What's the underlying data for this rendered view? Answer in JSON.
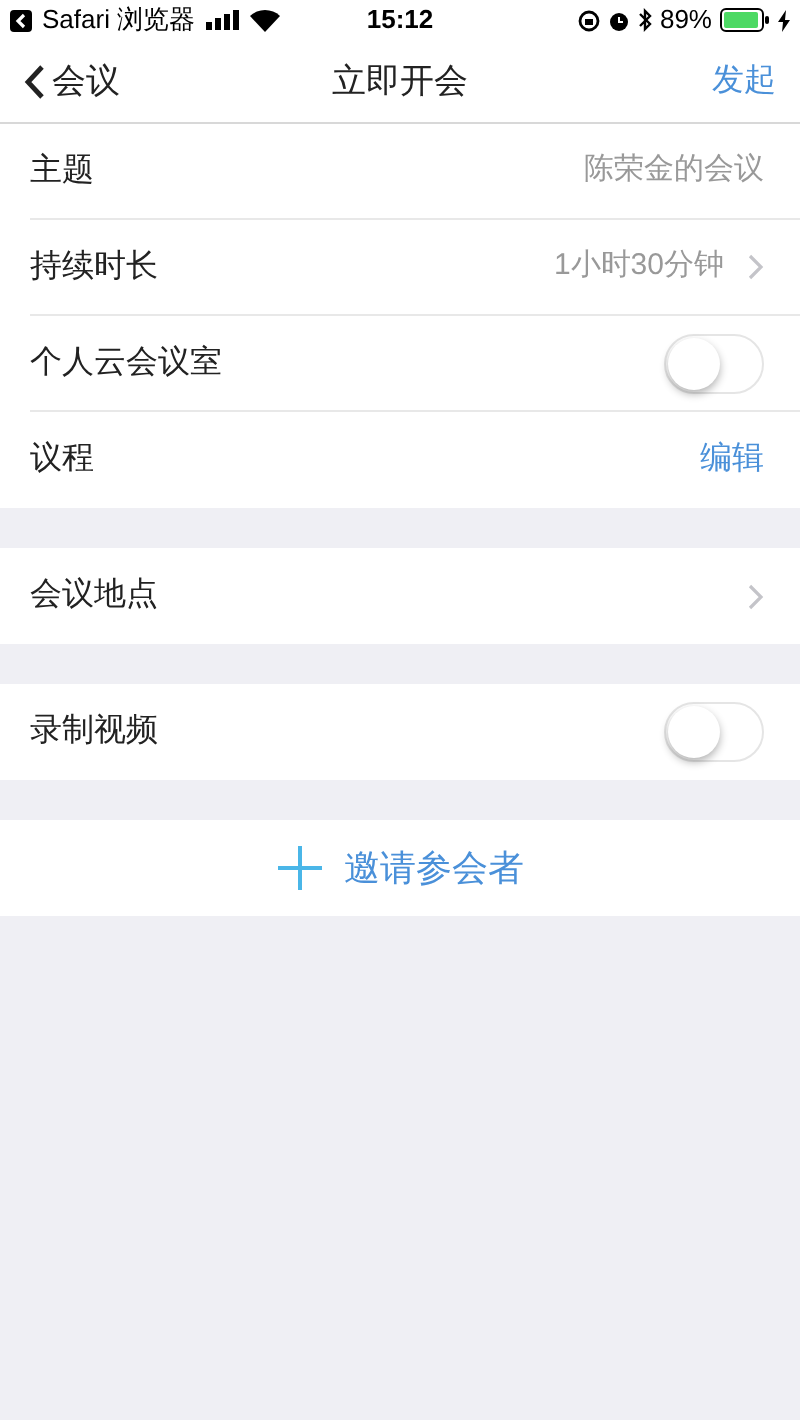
{
  "status_bar": {
    "back_app": "Safari 浏览器",
    "time": "15:12",
    "battery": "89%"
  },
  "nav": {
    "back": "会议",
    "title": "立即开会",
    "action": "发起"
  },
  "sections": [
    {
      "rows": [
        {
          "kind": "value",
          "label": "主题",
          "value": "陈荣金的会议",
          "chevron": false
        },
        {
          "kind": "value",
          "label": "持续时长",
          "value": "1小时30分钟",
          "chevron": true
        },
        {
          "kind": "toggle",
          "label": "个人云会议室",
          "on": false
        },
        {
          "kind": "link",
          "label": "议程",
          "value": "编辑"
        }
      ]
    },
    {
      "rows": [
        {
          "kind": "value",
          "label": "会议地点",
          "chevron": true
        }
      ]
    },
    {
      "rows": [
        {
          "kind": "toggle",
          "label": "录制视频",
          "on": false
        }
      ]
    }
  ],
  "invite": {
    "label": "邀请参会者"
  }
}
